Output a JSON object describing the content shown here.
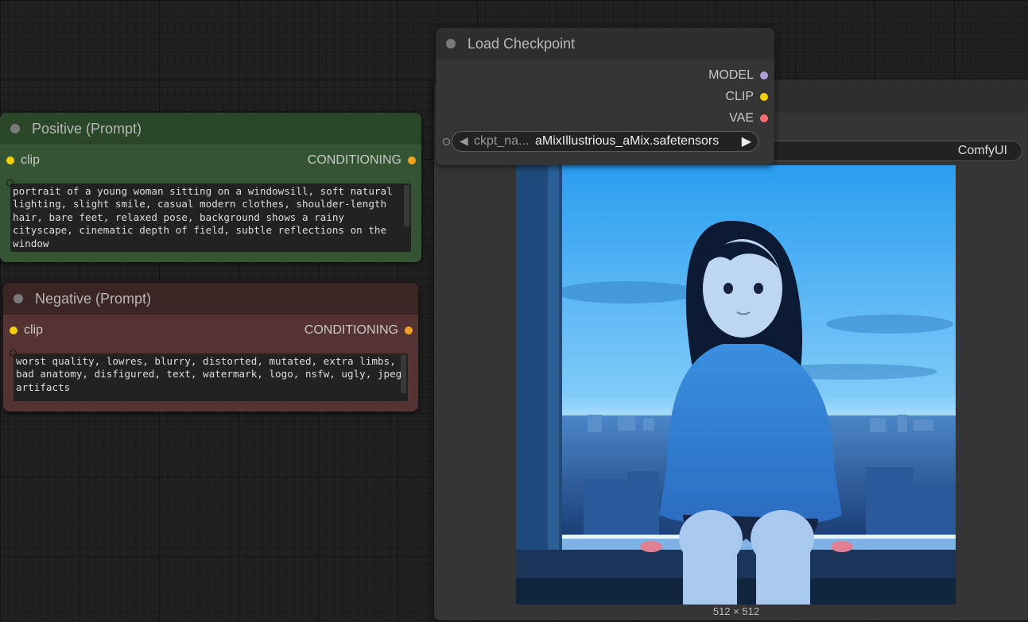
{
  "positive": {
    "title": "Positive (Prompt)",
    "input_label": "clip",
    "output_label": "CONDITIONING",
    "text": "portrait of a young woman sitting on a windowsill, soft natural lighting, slight smile, casual modern clothes, shoulder-length hair, bare feet, relaxed pose, background shows a rainy cityscape, cinematic depth of field, subtle reflections on the window"
  },
  "negative": {
    "title": "Negative (Prompt)",
    "input_label": "clip",
    "output_label": "CONDITIONING",
    "text": "worst quality, lowres, blurry, distorted, mutated, extra limbs, bad anatomy, disfigured, text, watermark, logo, nsfw, ugly, jpeg artifacts"
  },
  "checkpoint": {
    "title": "Load Checkpoint",
    "outputs": [
      "MODEL",
      "CLIP",
      "VAE"
    ],
    "widget_name": "ckpt_na...",
    "widget_value": "aMixIllustrious_aMix.safetensors"
  },
  "preview": {
    "filename_prefix": "ComfyUI",
    "image_size": "512 × 512"
  },
  "colors": {
    "clip_slot": "#f5d000",
    "conditioning_slot": "#f5a020",
    "model_slot": "#b39ddb",
    "vae_slot": "#ff6e6e",
    "positive_node": "#335533",
    "negative_node": "#553333"
  }
}
